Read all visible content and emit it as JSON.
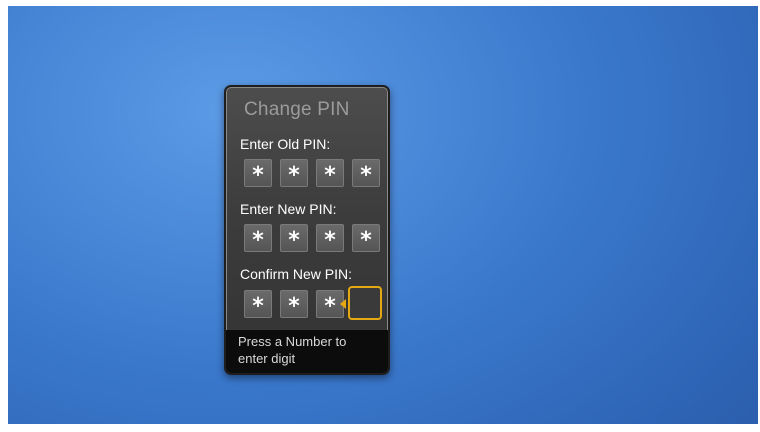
{
  "dialog": {
    "title": "Change PIN",
    "sections": [
      {
        "label": "Enter Old PIN:",
        "digits": [
          "*",
          "*",
          "*",
          "*"
        ]
      },
      {
        "label": "Enter New PIN:",
        "digits": [
          "*",
          "*",
          "*",
          "*"
        ]
      },
      {
        "label": "Confirm New PIN:",
        "digits": [
          "*",
          "*",
          "*",
          ""
        ]
      }
    ],
    "hint": "Press a Number to enter digit"
  },
  "colors": {
    "background": "#3a78cc",
    "dialog_bg": "#3c3c3c",
    "focus_accent": "#e2a913",
    "title_text": "#9b9b9b",
    "hint_bar": "#0c0c0c"
  },
  "icons": {
    "focus_indicator": "left-pointing-triangle"
  }
}
